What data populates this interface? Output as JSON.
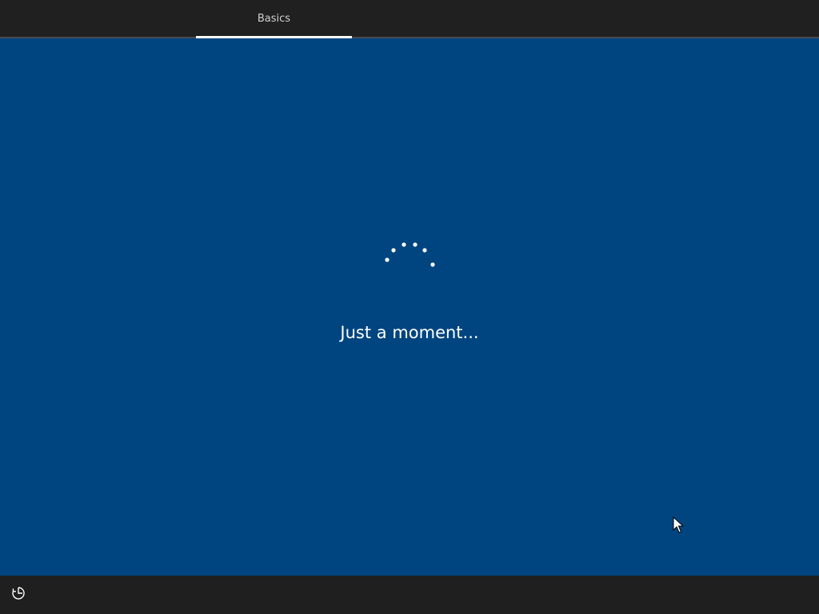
{
  "header": {
    "tabs": [
      {
        "label": "Basics",
        "active": true
      }
    ]
  },
  "main": {
    "status_text": "Just a moment...",
    "spinner_icon": "loading-dots-icon"
  },
  "footer": {
    "ease_of_access_icon": "ease-of-access-icon"
  },
  "colors": {
    "background": "#004580",
    "bar_background": "#202020",
    "text": "#ffffff"
  }
}
